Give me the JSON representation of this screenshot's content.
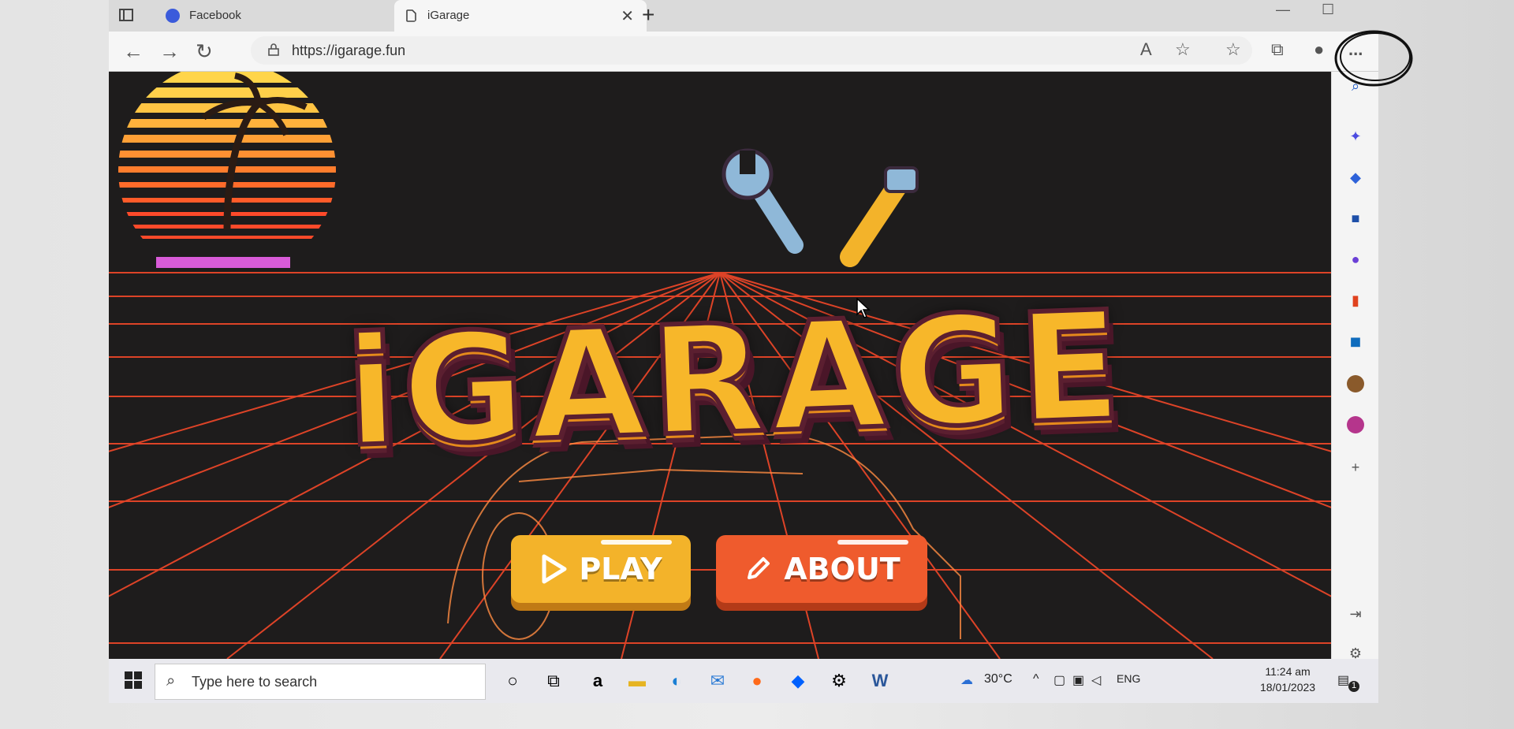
{
  "browser": {
    "tabs": [
      {
        "title": "Facebook",
        "favicon": "facebook-icon"
      },
      {
        "title": "iGarage",
        "favicon": "page-icon",
        "active": true
      }
    ],
    "url": "https://igarage.fun",
    "more_menu": "..."
  },
  "page": {
    "logo_text": "iGARAGE",
    "buttons": {
      "play": "PLAY",
      "about": "ABOUT"
    }
  },
  "taskbar": {
    "search_placeholder": "Type here to search",
    "weather": "30°C",
    "language": "ENG",
    "time": "11:24 am",
    "date": "18/01/2023",
    "notification_count": "1"
  },
  "colors": {
    "play": "#f3b32a",
    "about": "#ef5b2d",
    "grid": "#ff4a2a",
    "logo": "#f7b72a"
  }
}
